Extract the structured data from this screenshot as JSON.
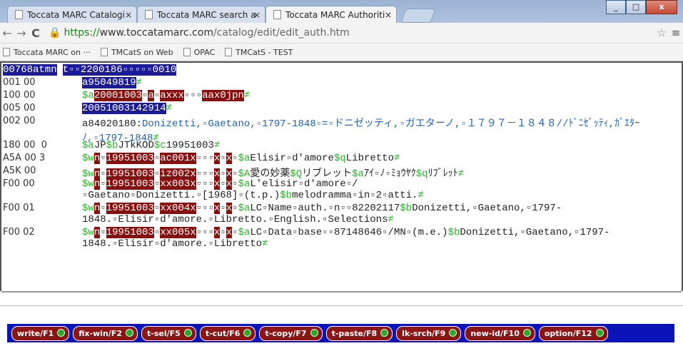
{
  "tabs": [
    {
      "label": "Toccata MARC Catalogi",
      "active": false
    },
    {
      "label": "Toccata MARC search a",
      "active": false
    },
    {
      "label": "Toccata MARC Authoriti",
      "active": true
    }
  ],
  "window_buttons": {
    "minimize": "_",
    "maximize": "□",
    "close": "x"
  },
  "address": {
    "scheme": "https://",
    "host": "www.toccatamarc.com",
    "path": "/catalog/edit/edit_auth.htm"
  },
  "bookmarks": [
    "Toccata MARC on ···",
    "TMCatS on Web",
    "OPAC",
    "TMCatS - TEST"
  ],
  "record": {
    "leader": {
      "a": "00768atmn",
      "b": "t▫▫2200186▫▫▫▫▫0010"
    },
    "rows": [
      {
        "tag": "001 00",
        "segments": [
          {
            "t": "a95049819",
            "c": "hb"
          },
          {
            "t": "≠",
            "c": "neq"
          }
        ]
      },
      {
        "tag": "100 00",
        "segments": [
          {
            "t": "$a",
            "c": "sub"
          },
          {
            "t": "20001003",
            "c": "hl"
          },
          {
            "t": "▫",
            "c": ""
          },
          {
            "t": "a",
            "c": "hl"
          },
          {
            "t": "▫",
            "c": ""
          },
          {
            "t": "axxx",
            "c": "hl"
          },
          {
            "t": "▫▫▫",
            "c": ""
          },
          {
            "t": "aax0jpn",
            "c": "hl"
          },
          {
            "t": "≠",
            "c": "neq"
          }
        ]
      },
      {
        "tag": "005 00",
        "segments": [
          {
            "t": "20051003142914",
            "c": "hb"
          },
          {
            "t": "≠",
            "c": "neq"
          }
        ]
      },
      {
        "tag": "002 00",
        "segments": [
          {
            "t": "a84020180:",
            "c": ""
          },
          {
            "t": "Donizetti,▫Gaetano,▫1797-1848▫=▫ドニゼッティ,▫ガエターノ,▫１７９７－１８４８//ﾄﾞﾆｾﾞｯﾃｨ,ｶﾞｴﾀｰﾉ,▫1797-1848",
            "c": "jp"
          },
          {
            "t": "≠",
            "c": "neq"
          }
        ]
      },
      {
        "tag": "180 00  0",
        "segments": [
          {
            "t": "$a",
            "c": "sub"
          },
          {
            "t": "JP",
            "c": ""
          },
          {
            "t": "$b",
            "c": "sub"
          },
          {
            "t": "JTkKOD",
            "c": ""
          },
          {
            "t": "$c",
            "c": "sub"
          },
          {
            "t": "19951003",
            "c": ""
          },
          {
            "t": "≠",
            "c": "neq"
          }
        ]
      },
      {
        "tag": "A5A 00 3",
        "segments": [
          {
            "t": "$w",
            "c": "sub"
          },
          {
            "t": "n",
            "c": "hl"
          },
          {
            "t": "▫",
            "c": ""
          },
          {
            "t": "19951003",
            "c": "hl"
          },
          {
            "t": "▫",
            "c": ""
          },
          {
            "t": "ac001x",
            "c": "hl"
          },
          {
            "t": "▫▫▫",
            "c": ""
          },
          {
            "t": "x",
            "c": "hl"
          },
          {
            "t": "▫",
            "c": ""
          },
          {
            "t": "x",
            "c": "hl"
          },
          {
            "t": "▫",
            "c": ""
          },
          {
            "t": "$a",
            "c": "sub"
          },
          {
            "t": "Elisir▫d'amore",
            "c": ""
          },
          {
            "t": "$q",
            "c": "sub"
          },
          {
            "t": "Libretto",
            "c": ""
          },
          {
            "t": "≠",
            "c": "neq"
          }
        ]
      },
      {
        "tag": "A5K 00",
        "segments": [
          {
            "t": "$w",
            "c": "sub"
          },
          {
            "t": "n",
            "c": "hl"
          },
          {
            "t": "▫",
            "c": ""
          },
          {
            "t": "19951003",
            "c": "hl"
          },
          {
            "t": "▫",
            "c": ""
          },
          {
            "t": "iz002x",
            "c": "hl"
          },
          {
            "t": "▫▫▫",
            "c": ""
          },
          {
            "t": "x",
            "c": "hl"
          },
          {
            "t": "▫",
            "c": ""
          },
          {
            "t": "x",
            "c": "hl"
          },
          {
            "t": "▫",
            "c": ""
          },
          {
            "t": "$A",
            "c": "sub"
          },
          {
            "t": "愛の妙薬",
            "c": ""
          },
          {
            "t": "$Q",
            "c": "sub"
          },
          {
            "t": "リブレット",
            "c": ""
          },
          {
            "t": "$a",
            "c": "sub"
          },
          {
            "t": "ｱｲ▫ﾉ▫ﾐｮｳﾔｸ",
            "c": ""
          },
          {
            "t": "$q",
            "c": "sub"
          },
          {
            "t": "ﾘﾌﾞﾚｯﾄ",
            "c": ""
          },
          {
            "t": "≠",
            "c": "neq"
          }
        ]
      },
      {
        "tag": "F00 00",
        "segments": [
          {
            "t": "$w",
            "c": "sub"
          },
          {
            "t": "n",
            "c": "hl"
          },
          {
            "t": "▫",
            "c": ""
          },
          {
            "t": "19951003",
            "c": "hl"
          },
          {
            "t": "▫",
            "c": ""
          },
          {
            "t": "xx003x",
            "c": "hl"
          },
          {
            "t": "▫▫▫",
            "c": ""
          },
          {
            "t": "x",
            "c": "hl"
          },
          {
            "t": "▫",
            "c": ""
          },
          {
            "t": "x",
            "c": "hl"
          },
          {
            "t": "▫",
            "c": ""
          },
          {
            "t": "$a",
            "c": "sub"
          },
          {
            "t": "L'elisir▫d'amore▫/▫Gaetano▫Donizetti.▫[1968]▫(t.p.)",
            "c": ""
          },
          {
            "t": "$b",
            "c": "sub"
          },
          {
            "t": "melodramma▫in▫2▫atti.",
            "c": ""
          },
          {
            "t": "≠",
            "c": "neq"
          }
        ]
      },
      {
        "tag": "F00 01",
        "segments": [
          {
            "t": "$w",
            "c": "sub"
          },
          {
            "t": "n",
            "c": "hl"
          },
          {
            "t": "▫",
            "c": ""
          },
          {
            "t": "19951003",
            "c": "hl"
          },
          {
            "t": "▫",
            "c": ""
          },
          {
            "t": "xx004x",
            "c": "hl"
          },
          {
            "t": "▫▫▫",
            "c": ""
          },
          {
            "t": "x",
            "c": "hl"
          },
          {
            "t": "▫",
            "c": ""
          },
          {
            "t": "x",
            "c": "hl"
          },
          {
            "t": "▫",
            "c": ""
          },
          {
            "t": "$a",
            "c": "sub"
          },
          {
            "t": "LC▫Name▫auth.▫n▫▫82202117",
            "c": ""
          },
          {
            "t": "$b",
            "c": "sub"
          },
          {
            "t": "Donizetti,▫Gaetano,▫1797-1848.▫Elisir▫d'amore.▫Libretto.▫English.▫Selections",
            "c": ""
          },
          {
            "t": "≠",
            "c": "neq"
          }
        ]
      },
      {
        "tag": "F00 02",
        "segments": [
          {
            "t": "$w",
            "c": "sub"
          },
          {
            "t": "n",
            "c": "hl"
          },
          {
            "t": "▫",
            "c": ""
          },
          {
            "t": "19951003",
            "c": "hl"
          },
          {
            "t": "▫",
            "c": ""
          },
          {
            "t": "xx005x",
            "c": "hl"
          },
          {
            "t": "▫▫▫",
            "c": ""
          },
          {
            "t": "x",
            "c": "hl"
          },
          {
            "t": "▫",
            "c": ""
          },
          {
            "t": "x",
            "c": "hl"
          },
          {
            "t": "▫",
            "c": ""
          },
          {
            "t": "$a",
            "c": "sub"
          },
          {
            "t": "LC▫Data▫base▫▫87148646▫/MN▫(m.e.)",
            "c": ""
          },
          {
            "t": "$b",
            "c": "sub"
          },
          {
            "t": "Donizetti,▫Gaetano,▫1797-1848.▫Elisir▫d'amore.▫Libretto",
            "c": ""
          },
          {
            "t": "≠",
            "c": "neq"
          }
        ]
      }
    ]
  },
  "function_keys": [
    "write/F1",
    "fix-win/F2",
    "t-sel/F5",
    "t-cut/F6",
    "t-copy/F7",
    "t-paste/F8",
    "lk-srch/F9",
    "new-id/F10",
    "option/F12"
  ]
}
